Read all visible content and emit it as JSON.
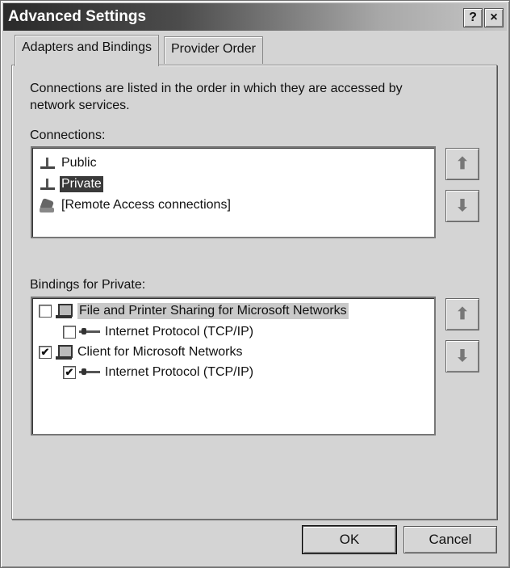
{
  "window": {
    "title": "Advanced Settings",
    "help_button": "?",
    "close_button": "×"
  },
  "tabs": [
    {
      "label": "Adapters and Bindings",
      "active": true
    },
    {
      "label": "Provider Order",
      "active": false
    }
  ],
  "description": "Connections are listed in the order in which they are accessed by network services.",
  "connections": {
    "label": "Connections:",
    "items": [
      {
        "label": "Public",
        "icon": "network-adapter-icon",
        "selected": false
      },
      {
        "label": "Private",
        "icon": "network-adapter-icon",
        "selected": true
      },
      {
        "label": "[Remote Access connections]",
        "icon": "remote-access-icon",
        "selected": false
      }
    ],
    "up_button": "⬆",
    "down_button": "⬇"
  },
  "bindings": {
    "label": "Bindings for Private:",
    "items": [
      {
        "label": "File and Printer Sharing for Microsoft Networks",
        "checked": false,
        "level": 0,
        "icon": "service-icon",
        "highlighted": true
      },
      {
        "label": "Internet Protocol (TCP/IP)",
        "checked": false,
        "level": 1,
        "icon": "protocol-icon",
        "highlighted": false
      },
      {
        "label": "Client for Microsoft Networks",
        "checked": true,
        "level": 0,
        "icon": "client-icon",
        "highlighted": false
      },
      {
        "label": "Internet Protocol (TCP/IP)",
        "checked": true,
        "level": 1,
        "icon": "protocol-icon",
        "highlighted": false
      }
    ],
    "up_button": "⬆",
    "down_button": "⬇"
  },
  "buttons": {
    "ok": "OK",
    "cancel": "Cancel"
  },
  "check_mark": "✔"
}
